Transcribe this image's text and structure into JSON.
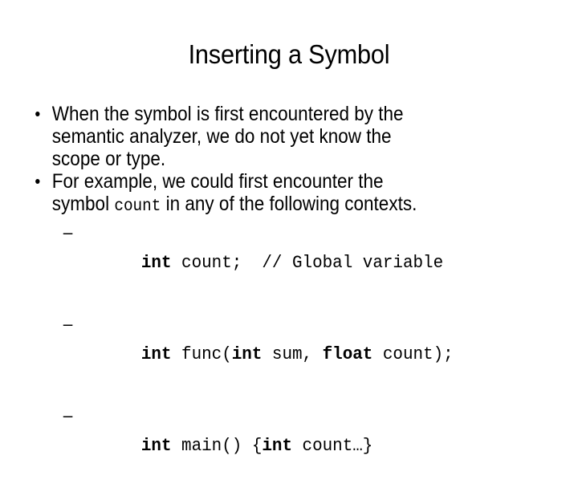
{
  "slide": {
    "title": "Inserting a Symbol",
    "background_color": "#ffffff",
    "text_color": "#000000",
    "bullets": [
      {
        "level": 1,
        "marker": "•",
        "segments": [
          {
            "text": "When the symbol is first encountered by the semantic analyzer, we do not yet know the scope or type.",
            "style": "normal"
          }
        ]
      },
      {
        "level": 1,
        "marker": "•",
        "segments": [
          {
            "text": "For example, we could first encounter the symbol ",
            "style": "normal"
          },
          {
            "text": "count",
            "style": "mono"
          },
          {
            "text": " in any of the following contexts.",
            "style": "normal"
          }
        ]
      },
      {
        "level": 2,
        "marker": "–",
        "segments": [
          {
            "text": "int",
            "style": "mono-bold"
          },
          {
            "text": " count;  ",
            "style": "mono"
          },
          {
            "text": "// Global variable",
            "style": "mono"
          }
        ]
      },
      {
        "level": 2,
        "marker": "–",
        "segments": [
          {
            "text": "int",
            "style": "mono-bold"
          },
          {
            "text": " func(",
            "style": "mono"
          },
          {
            "text": "int",
            "style": "mono-bold"
          },
          {
            "text": " sum, ",
            "style": "mono"
          },
          {
            "text": "float",
            "style": "mono-bold"
          },
          {
            "text": " count);",
            "style": "mono"
          }
        ]
      },
      {
        "level": 2,
        "marker": "–",
        "segments": [
          {
            "text": "int",
            "style": "mono-bold"
          },
          {
            "text": " main() {",
            "style": "mono"
          },
          {
            "text": "int",
            "style": "mono-bold"
          },
          {
            "text": " count…}",
            "style": "mono"
          }
        ]
      }
    ],
    "bullet1_line1": "When the symbol is first encountered by the",
    "bullet1_line2": "semantic analyzer, we do not yet know the",
    "bullet1_line3": "scope or type.",
    "bullet2_line1": "For example, we could first encounter the",
    "bullet2_pre": "symbol ",
    "bullet2_mono": "count",
    "bullet2_post": " in any of the following contexts.",
    "code1_kw": "int",
    "code1_rest": " count;  // Global variable",
    "code2_kw1": "int",
    "code2_mid1": " func(",
    "code2_kw2": "int",
    "code2_mid2": " sum, ",
    "code2_kw3": "float",
    "code2_tail": " count);",
    "code3_kw1": "int",
    "code3_mid1": " main() {",
    "code3_kw2": "int",
    "code3_tail": " count…}",
    "dash_marker": "–"
  }
}
